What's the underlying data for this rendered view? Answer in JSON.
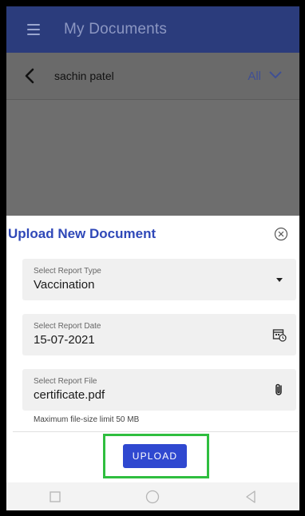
{
  "appbar": {
    "title": "My Documents"
  },
  "subbar": {
    "user_name": "sachin patel",
    "filter_label": "All"
  },
  "sheet": {
    "title": "Upload New Document",
    "fields": [
      {
        "label": "Select Report Type",
        "value": "Vaccination",
        "icon": "dropdown-arrow-icon"
      },
      {
        "label": "Select Report Date",
        "value": "15-07-2021",
        "icon": "calendar-icon"
      },
      {
        "label": "Select Report File",
        "value": "certificate.pdf",
        "icon": "attachment-icon"
      }
    ],
    "hint": "Maximum file-size limit 50 MB",
    "upload_label": "UPLOAD"
  },
  "colors": {
    "appbar": "#2b3c7c",
    "primary": "#2f48b8",
    "highlight": "#2fbe3f"
  }
}
